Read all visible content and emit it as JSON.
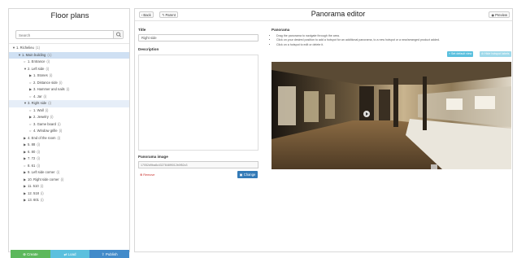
{
  "sidebar": {
    "title": "Floor plans",
    "search_placeholder": "Search",
    "tree": [
      {
        "label": "1. Richelieu",
        "count": "(1)",
        "arrow": "▼",
        "indent": 0
      },
      {
        "label": "1. Main building",
        "count": "(1)",
        "arrow": "▼",
        "indent": 1,
        "state": "sel"
      },
      {
        "label": "1. Entrance",
        "count": "(i)",
        "arrow": "○",
        "indent": 2
      },
      {
        "label": "2. Left side",
        "count": "(i)",
        "arrow": "▼",
        "indent": 2
      },
      {
        "label": "1. Stones",
        "count": "(i)",
        "arrow": "▶",
        "indent": 3
      },
      {
        "label": "2. Distance side",
        "count": "(i)",
        "arrow": "○",
        "indent": 3
      },
      {
        "label": "3. Hammer and nails",
        "count": "(i)",
        "arrow": "▶",
        "indent": 3
      },
      {
        "label": "4. Jar",
        "count": "(i)",
        "arrow": "○",
        "indent": 3
      },
      {
        "label": "3. Right side",
        "count": "(i)",
        "arrow": "▼",
        "indent": 2,
        "state": "sel-light"
      },
      {
        "label": "1. Wall",
        "count": "(i)",
        "arrow": "○",
        "indent": 3
      },
      {
        "label": "2. Jewelry",
        "count": "(i)",
        "arrow": "▶",
        "indent": 3
      },
      {
        "label": "3. Game board",
        "count": "(i)",
        "arrow": "○",
        "indent": 3
      },
      {
        "label": "4. Window grille",
        "count": "(i)",
        "arrow": "○",
        "indent": 3
      },
      {
        "label": "4. End of the room",
        "count": "(i)",
        "arrow": "▶",
        "indent": 2
      },
      {
        "label": "5. 88",
        "count": "(i)",
        "arrow": "▶",
        "indent": 2
      },
      {
        "label": "6. 80",
        "count": "(i)",
        "arrow": "▶",
        "indent": 2
      },
      {
        "label": "7. 72",
        "count": "(i)",
        "arrow": "▶",
        "indent": 2
      },
      {
        "label": "8. 61",
        "count": "(i)",
        "arrow": "○",
        "indent": 2
      },
      {
        "label": "9. Left side corner",
        "count": "(i)",
        "arrow": "▶",
        "indent": 2
      },
      {
        "label": "10. Right side corner",
        "count": "(i)",
        "arrow": "▶",
        "indent": 2
      },
      {
        "label": "11. 510",
        "count": "(i)",
        "arrow": "▶",
        "indent": 2
      },
      {
        "label": "12. 518",
        "count": "(i)",
        "arrow": "▶",
        "indent": 2
      },
      {
        "label": "13. 601",
        "count": "(i)",
        "arrow": "▶",
        "indent": 2
      }
    ],
    "actions": {
      "create": "Create",
      "load": "Load",
      "publish": "Publish"
    }
  },
  "toolbar": {
    "back": "Back",
    "parent": "Parent",
    "preview": "Preview"
  },
  "editor": {
    "title": "Panorama editor",
    "title_label": "Title",
    "title_value": "Right side",
    "description_label": "Description",
    "panorama_image_label": "Panorama image",
    "panorama_image_value": "17052d9ba8c4327848f9012b0f52c3",
    "remove_label": "Remove",
    "change_label": "Change",
    "panorama_label": "Panorama",
    "instructions": [
      "Drag the panorama to navigate through the area.",
      "Click on your desired position to add a hotspot for an additional panorama, to a new hotspot or a new/arranged product added.",
      "Click on a hotspot to edit or delete it."
    ],
    "set_default_view": "Set default view",
    "hide_labels": "Hide hotspot labels"
  },
  "colors": {
    "create": "#5cb85c",
    "load": "#5bc0de",
    "publish": "#428bca",
    "selected_row": "#cfe0f3",
    "change_button": "#337ab7"
  }
}
